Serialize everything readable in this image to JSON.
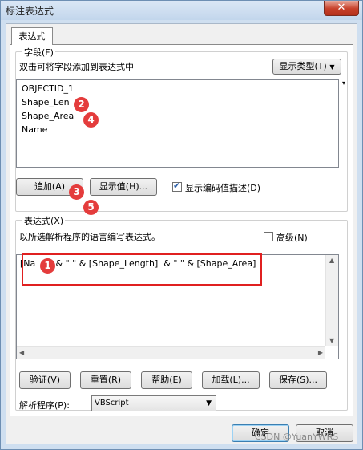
{
  "window": {
    "title": "标注表达式",
    "close_glyph": "✕"
  },
  "tab": {
    "label": "表达式"
  },
  "fields_group": {
    "legend": "字段(F)",
    "hint": "双击可将字段添加到表达式中",
    "show_types_button": "显示类型(T)",
    "items": [
      "OBJECTID_1",
      "Shape_Len",
      "Shape_Area",
      "Name"
    ],
    "add_button": "追加(A)",
    "show_values_button": "显示值(H)...",
    "show_coded_desc_label": "显示编码值描述(D)",
    "show_coded_desc_checked": true
  },
  "expression_group": {
    "legend": "表达式(X)",
    "hint": "以所选解析程序的语言编写表达式。",
    "advanced_label": "高级(N)",
    "advanced_checked": false,
    "expression_text": "[Na    ]  & \" \" & [Shape_Length]  & \" \" & [Shape_Area]",
    "verify_button": "验证(V)",
    "reset_button": "重置(R)",
    "help_button": "帮助(E)",
    "load_button": "加载(L)...",
    "save_button": "保存(S)...",
    "parser_label": "解析程序(P):",
    "parser_value": "VBScript"
  },
  "footer": {
    "ok_button": "确定",
    "cancel_button": "取消"
  },
  "markers": [
    "1",
    "2",
    "3",
    "4",
    "5"
  ],
  "watermark": "CSDN @YuanYWRS",
  "colors": {
    "marker": "#e43c3c",
    "highlight": "#e02020"
  }
}
